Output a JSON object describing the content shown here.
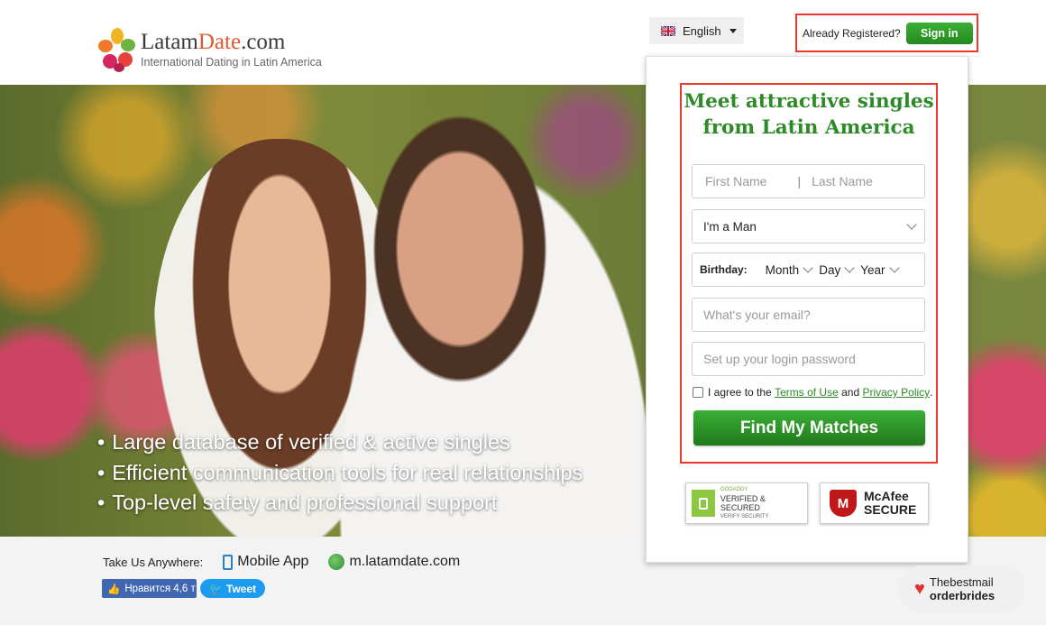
{
  "header": {
    "logo_name_part1": "Latam",
    "logo_name_part2": "Date",
    "logo_name_part3": ".com",
    "tagline": "International Dating in Latin America",
    "language": "English",
    "already_registered": "Already Registered?",
    "sign_in": "Sign in"
  },
  "hero": {
    "bullets": [
      "Large database of verified & active singles",
      "Efficient communication tools for real relationships",
      "Top-level safety and professional support"
    ]
  },
  "form": {
    "title": "Meet attractive singles from Latin America",
    "first_name_placeholder": "First Name",
    "last_name_placeholder": "Last Name",
    "gender_value": "I'm a Man",
    "birthday_label": "Birthday:",
    "month": "Month",
    "day": "Day",
    "year": "Year",
    "email_placeholder": "What's your email?",
    "password_placeholder": "Set up your login password",
    "agree_prefix": "I agree to the",
    "terms_link": "Terms of Use",
    "agree_and": "and",
    "privacy_link": "Privacy Policy",
    "agree_suffix": ".",
    "submit": "Find My Matches"
  },
  "badges": {
    "godaddy_line1": "GODADDY",
    "godaddy_line2": "VERIFIED & SECURED",
    "godaddy_line3": "VERIFY SECURITY",
    "mcafee_line1": "McAfee",
    "mcafee_line2": "SECURE"
  },
  "footer": {
    "take_us": "Take Us Anywhere:",
    "mobile_app": "Mobile App",
    "mobile_site": "m.latamdate.com",
    "fb_like": "Нравится 4,6 т",
    "tweet": "Tweet"
  },
  "watermark": {
    "line1": "Thebestmail",
    "line2": "orderbrides"
  },
  "colors": {
    "brand_green": "#2c8a27",
    "highlight_red": "#e8392e",
    "accent_orange": "#e4572e"
  }
}
